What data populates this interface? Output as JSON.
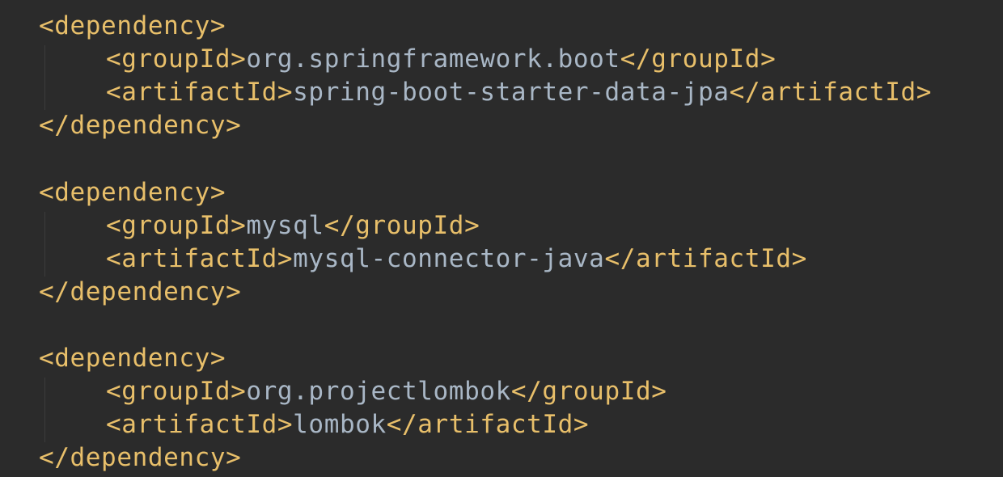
{
  "editor": {
    "colors": {
      "background": "#2b2b2b",
      "tag": "#e8bf6a",
      "text": "#a9b7c6",
      "indent_guide": "#3d3d3d"
    },
    "blocks": [
      {
        "open": "<dependency>",
        "group_open": "<groupId>",
        "group_value": "org.springframework.boot",
        "group_close": "</groupId>",
        "artifact_open": "<artifactId>",
        "artifact_value": "spring-boot-starter-data-jpa",
        "artifact_close": "</artifactId>",
        "close": "</dependency>"
      },
      {
        "open": "<dependency>",
        "group_open": "<groupId>",
        "group_value": "mysql",
        "group_close": "</groupId>",
        "artifact_open": "<artifactId>",
        "artifact_value": "mysql-connector-java",
        "artifact_close": "</artifactId>",
        "close": "</dependency>"
      },
      {
        "open": "<dependency>",
        "group_open": "<groupId>",
        "group_value": "org.projectlombok",
        "group_close": "</groupId>",
        "artifact_open": "<artifactId>",
        "artifact_value": "lombok",
        "artifact_close": "</artifactId>",
        "close": "</dependency>"
      }
    ]
  }
}
